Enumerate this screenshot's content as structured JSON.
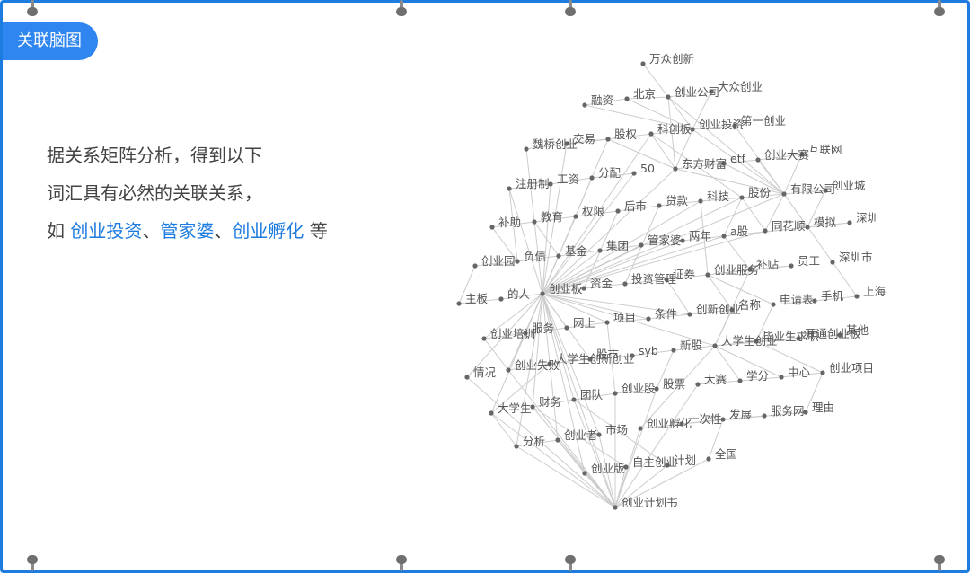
{
  "header": {
    "badge": "关联脑图"
  },
  "description": {
    "line1": "据关系矩阵分析，得到以下",
    "line2": "词汇具有必然的关联关系，",
    "line3_prefix": "如 ",
    "hl1": "创业投资",
    "sep1": "、",
    "hl2": "管家婆",
    "sep2": "、",
    "hl3": "创业孵化",
    "line3_suffix": " 等"
  },
  "colors": {
    "frame": "#1e7be0",
    "badge": "#2f86f0",
    "highlight": "#1e7be0",
    "node": "#666666",
    "edge": "#cccccc"
  },
  "graph": {
    "nodes": [
      "万众创新",
      "大众创业",
      "北京",
      "创业公司",
      "融资",
      "第一创业",
      "创业投资",
      "科创板",
      "股权",
      "交易",
      "魏桥创业",
      "互联网",
      "创业大赛",
      "etf",
      "东方财富",
      "50",
      "分配",
      "工资",
      "注册制",
      "创业城",
      "有限公司",
      "股份",
      "科技",
      "贷款",
      "后市",
      "权限",
      "教育",
      "补助",
      "深圳",
      "模拟",
      "同花顺",
      "a股",
      "两年",
      "管家婆",
      "集团",
      "基金",
      "负债",
      "创业园",
      "深圳市",
      "员工",
      "补贴",
      "创业服务",
      "证券",
      "投资管理",
      "资金",
      "创业板",
      "的人",
      "主板",
      "上海",
      "手机",
      "申请表",
      "名称",
      "创新创业",
      "条件",
      "项目",
      "网上",
      "服务",
      "创业培训",
      "其他",
      "开通创业板",
      "毕业生求职",
      "大学生创业",
      "新股",
      "syb",
      "股市",
      "大学生创新创业",
      "创业失败",
      "情况",
      "创业项目",
      "中心",
      "学分",
      "大赛",
      "股票",
      "创业股",
      "团队",
      "财务",
      "大学生",
      "理由",
      "服务网",
      "发展",
      "一次性",
      "创业孵化",
      "市场",
      "创业者",
      "分析",
      "全国",
      "计划",
      "自主创业",
      "创业版",
      "创业计划书"
    ]
  }
}
